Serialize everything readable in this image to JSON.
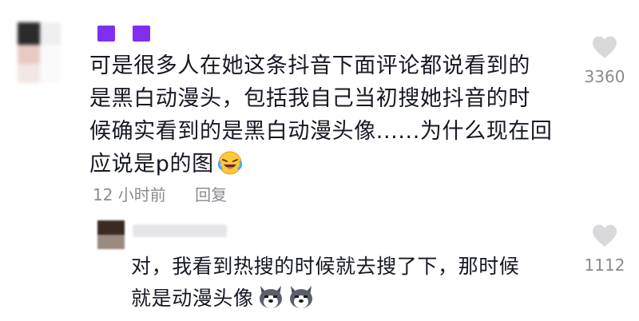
{
  "main_comment": {
    "username": "",
    "text_lines": [
      "可是很多人在她这条抖音下面评论都说看到的",
      "是黑白动漫头，包括我自己当初搜她抖音的时",
      "候确实看到的是黑白动漫头像......为什么现在回",
      "应说是p的图"
    ],
    "emoji": "laughing-crying-emoji",
    "time": "12 小时前",
    "reply_label": "回复",
    "like_count": "3360",
    "like_icon": "heart-icon"
  },
  "reply_comment": {
    "username": "",
    "text_lines": [
      "对，我看到热搜的时候就去搜了下，那时候",
      "就是动漫头像"
    ],
    "emojis": [
      "husky-emoji",
      "husky-emoji"
    ],
    "like_count": "1112",
    "like_icon": "heart-icon"
  },
  "colors": {
    "text": "#161823",
    "meta": "#8a8b91",
    "heart": "#d9d9dc",
    "username_block": "#7f2ff0"
  }
}
